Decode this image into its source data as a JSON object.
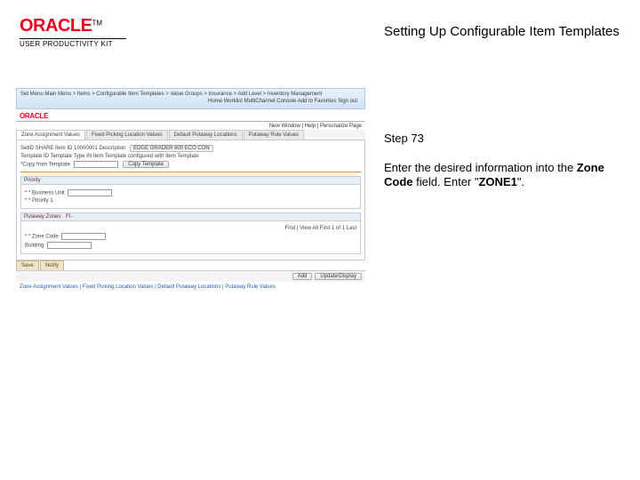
{
  "logo": {
    "brand": "ORACLE",
    "tm": "TM",
    "sub": "USER PRODUCTIVITY KIT"
  },
  "title": "Setting Up Configurable Item Templates",
  "step": "Step 73",
  "desc": {
    "pre": "Enter the desired information into the ",
    "field": "Zone Code",
    "mid": " field. Enter \"",
    "value": "ZONE1",
    "post": "\"."
  },
  "shot": {
    "breadcrumb": "Set Menu     Main Menu > Items > Configurable Item Templates > Value Groups > Insurance > Add Level > Inventory Management",
    "navlinks": "Home    Worklist    MultiChannel Console    Add to Favorites    Sign out",
    "oracle": "ORACLE",
    "subnav": "New Window | Help | Personalize Page",
    "tabs": [
      "Zone Assignment Values",
      "Fixed Picking Location Values",
      "Default Putaway Locations",
      "Putaway Rule Values"
    ],
    "line1_l": "SetID  SHARE    Item ID  10000001    Description",
    "line1_r": "EDGE  GRADER 800 ECO CON",
    "line2": "Template ID   Template Type  IN    Item Template configured with Item Template",
    "line3_l": "*Copy from Template",
    "line3_btn": "Copy Template",
    "panel1": {
      "h": "Priority",
      "row1": "* Business Unit",
      "row2": "* Priority   1"
    },
    "panel2": {
      "h": "Putaway Zones",
      "row1": "FI-",
      "pager": "Find | View All      First  1  of  1  Last",
      "row2": "* Zone Code",
      "row3": "Building"
    },
    "btns": [
      "Save",
      "Notify"
    ],
    "btns_r": [
      "Add",
      "Update/Display"
    ],
    "bottom_tabs": [
      "Save",
      "Notify"
    ],
    "crumb": "Zone Assignment Values | Fixed Picking Location Values | Default Putaway Locations | Putaway Rule Values"
  }
}
